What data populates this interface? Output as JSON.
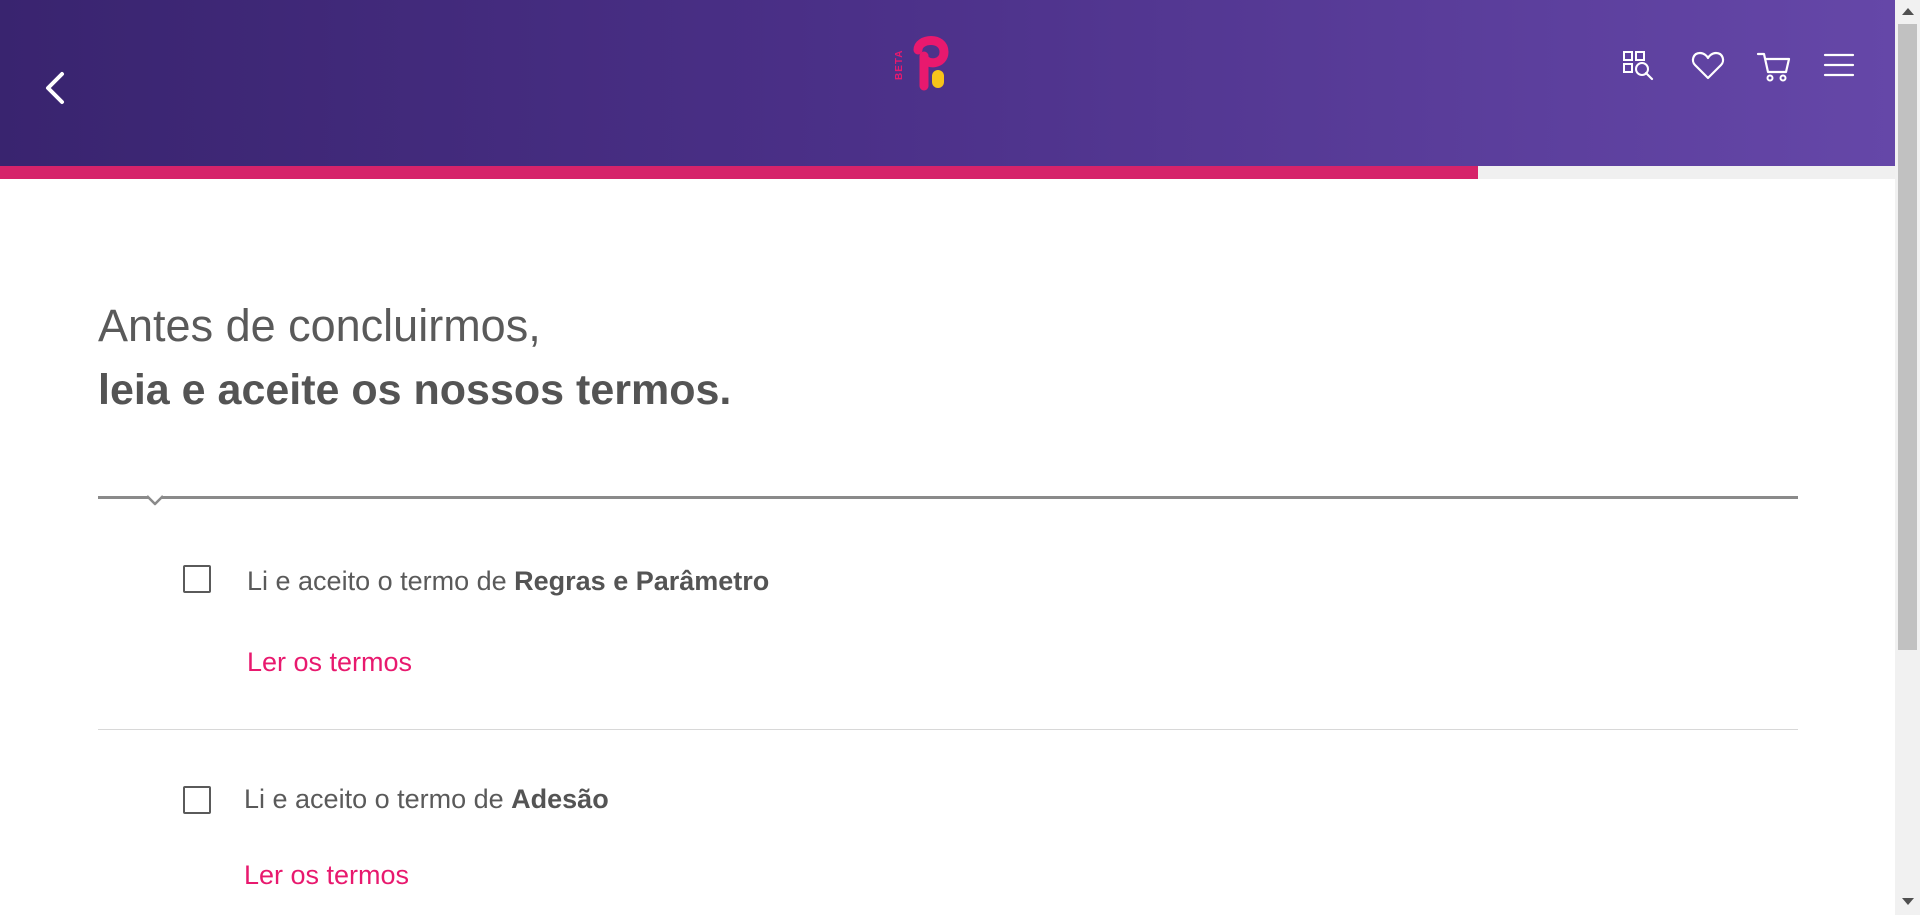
{
  "header": {
    "logo_badge": "BETA",
    "back_icon": "chevron-left-icon",
    "icons": [
      "product-search-icon",
      "heart-icon",
      "cart-icon",
      "menu-icon"
    ],
    "background_colors": [
      "#39246f",
      "#6547a8"
    ]
  },
  "progress": {
    "value": 0.78,
    "color": "#d6236a"
  },
  "title": {
    "line1": "Antes de concluirmos,",
    "line2": "leia e aceite os nossos termos."
  },
  "terms": [
    {
      "prefix": "Li e aceito o termo de ",
      "name": "Regras e Parâmetro",
      "link": "Ler os termos",
      "checked": false
    },
    {
      "prefix": "Li e aceito o termo de ",
      "name": "Adesão",
      "link": "Ler os termos",
      "checked": false
    }
  ],
  "colors": {
    "accent": "#e8196e",
    "text": "#5a5a5a"
  }
}
